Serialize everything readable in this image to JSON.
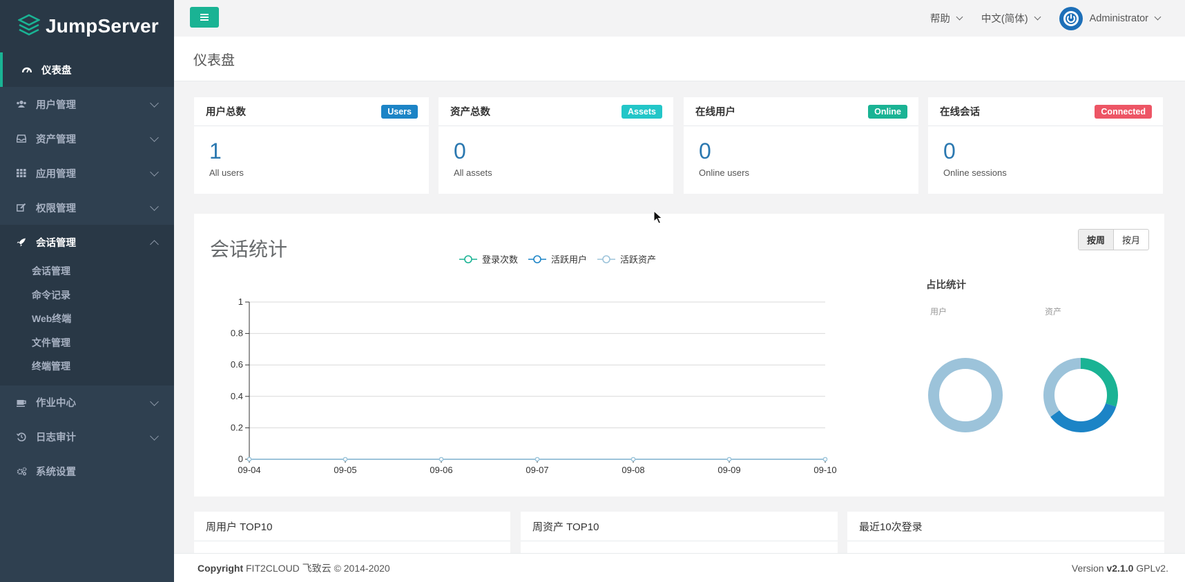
{
  "app": {
    "name": "JumpServer"
  },
  "sidebar": {
    "items": [
      {
        "label": "仪表盘",
        "icon": "dashboard-icon"
      },
      {
        "label": "用户管理",
        "icon": "users-icon"
      },
      {
        "label": "资产管理",
        "icon": "inbox-icon"
      },
      {
        "label": "应用管理",
        "icon": "grid-icon"
      },
      {
        "label": "权限管理",
        "icon": "edit-icon"
      },
      {
        "label": "会话管理",
        "icon": "rocket-icon"
      },
      {
        "label": "作业中心",
        "icon": "coffee-icon"
      },
      {
        "label": "日志审计",
        "icon": "history-icon"
      },
      {
        "label": "系统设置",
        "icon": "gears-icon"
      }
    ],
    "sub_items": [
      "会话管理",
      "命令记录",
      "Web终端",
      "文件管理",
      "终端管理"
    ]
  },
  "topbar": {
    "help": "帮助",
    "language": "中文(简体)",
    "user": "Administrator"
  },
  "page": {
    "title": "仪表盘"
  },
  "stats": [
    {
      "title": "用户总数",
      "badge": "Users",
      "badge_color": "#1c84c6",
      "value": "1",
      "desc": "All users"
    },
    {
      "title": "资产总数",
      "badge": "Assets",
      "badge_color": "#23c6c8",
      "value": "0",
      "desc": "All assets"
    },
    {
      "title": "在线用户",
      "badge": "Online",
      "badge_color": "#1ab394",
      "value": "0",
      "desc": "Online users"
    },
    {
      "title": "在线会话",
      "badge": "Connected",
      "badge_color": "#ed5565",
      "value": "0",
      "desc": "Online sessions"
    }
  ],
  "session": {
    "title": "会话统计",
    "btn_week": "按周",
    "btn_month": "按月",
    "ratio_title": "占比统计",
    "ratio_user": "用户",
    "ratio_asset": "资产"
  },
  "chart_data": {
    "type": "line",
    "categories": [
      "09-04",
      "09-05",
      "09-06",
      "09-07",
      "09-08",
      "09-09",
      "09-10"
    ],
    "series": [
      {
        "name": "登录次数",
        "values": [
          0,
          0,
          0,
          0,
          0,
          0,
          0
        ],
        "color": "#1ab394"
      },
      {
        "name": "活跃用户",
        "values": [
          0,
          0,
          0,
          0,
          0,
          0,
          0
        ],
        "color": "#1c84c6"
      },
      {
        "name": "活跃资产",
        "values": [
          0,
          0,
          0,
          0,
          0,
          0,
          0
        ],
        "color": "#9cc3da"
      }
    ],
    "ylim": [
      0,
      1
    ],
    "yticks": [
      "0",
      "0.2",
      "0.4",
      "0.6",
      "0.8",
      "1"
    ],
    "grid": true,
    "legend": "top-center",
    "donuts": [
      {
        "label": "用户",
        "slices": [
          {
            "value": 1,
            "color": "#9cc3da"
          }
        ]
      },
      {
        "label": "资产",
        "slices": [
          {
            "value": 0.3,
            "color": "#1ab394"
          },
          {
            "value": 0.35,
            "color": "#1c84c6"
          },
          {
            "value": 0.35,
            "color": "#9cc3da"
          }
        ]
      }
    ]
  },
  "bottom": {
    "users_top": "周用户 TOP10",
    "assets_top": "周资产 TOP10",
    "last_login": "最近10次登录"
  },
  "footer": {
    "copyright_label": "Copyright",
    "copyright_text": "FIT2CLOUD 飞致云 © 2014-2020",
    "version_label": "Version",
    "version": "v2.1.0",
    "license": "GPLv2."
  }
}
